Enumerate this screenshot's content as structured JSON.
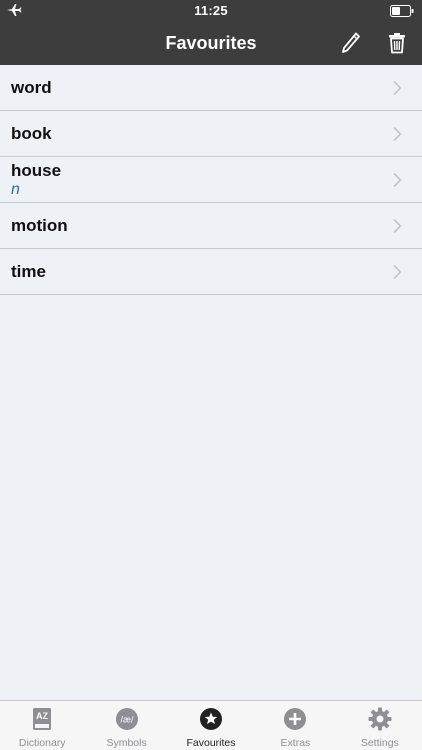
{
  "status_bar": {
    "time": "11:25",
    "left_icon": "airplane-icon",
    "right_icon": "battery-icon"
  },
  "nav": {
    "title": "Favourites",
    "edit_icon": "pencil-icon",
    "delete_icon": "trash-icon"
  },
  "favourites": [
    {
      "word": "word",
      "pos": ""
    },
    {
      "word": "book",
      "pos": ""
    },
    {
      "word": "house",
      "pos": "n"
    },
    {
      "word": "motion",
      "pos": ""
    },
    {
      "word": "time",
      "pos": ""
    }
  ],
  "tabs": [
    {
      "label": "Dictionary",
      "icon": "dictionary-az-icon",
      "active": false
    },
    {
      "label": "Symbols",
      "icon": "symbols-ipa-icon",
      "icon_text": "/æ/",
      "active": false
    },
    {
      "label": "Favourites",
      "icon": "star-icon",
      "active": true
    },
    {
      "label": "Extras",
      "icon": "plus-icon",
      "active": false
    },
    {
      "label": "Settings",
      "icon": "gear-icon",
      "active": false
    }
  ],
  "colors": {
    "nav_background": "#3d3d3d",
    "list_background": "#eef1f6",
    "pos_text": "#2a6fb0",
    "tab_inactive": "#8e8e93",
    "tab_active": "#222222"
  }
}
